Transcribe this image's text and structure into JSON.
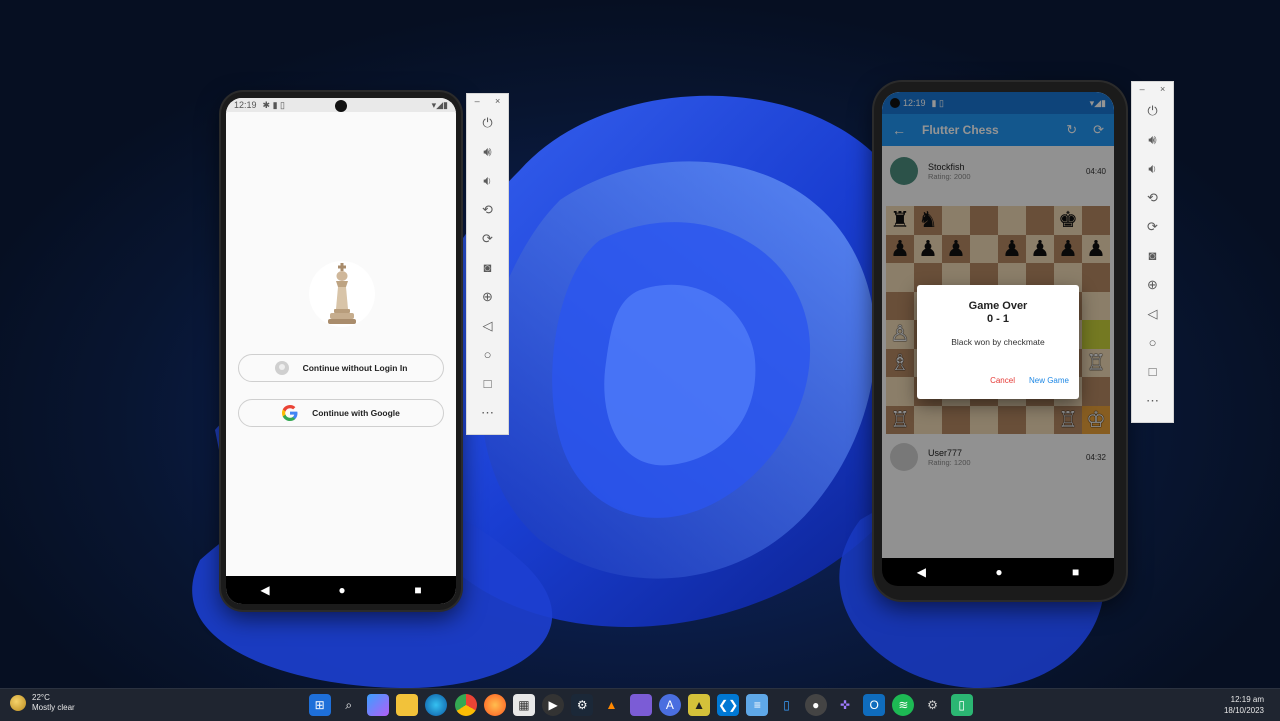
{
  "weather": {
    "temperature": "22°C",
    "condition": "Mostly clear"
  },
  "clock": {
    "time": "12:19 am",
    "date": "18/10/2023"
  },
  "phone_left": {
    "status_time": "12:19",
    "login_buttons": [
      {
        "label": "Continue without Login In",
        "icon": "avatar-icon"
      },
      {
        "label": "Continue with Google",
        "icon": "google-g-icon"
      }
    ],
    "nav": {
      "back": "◀",
      "home": "●",
      "recents": "■"
    }
  },
  "phone_right": {
    "status_time": "12:19",
    "app_title": "Flutter Chess",
    "opponent": {
      "name": "Stockfish",
      "rating": "Rating: 2000",
      "clock": "04:40"
    },
    "player": {
      "name": "User777",
      "rating": "Rating: 1200",
      "clock": "04:32"
    },
    "dialog": {
      "title": "Game Over",
      "score": "0 - 1",
      "message": "Black won by checkmate",
      "cancel": "Cancel",
      "new_game": "New Game"
    },
    "nav": {
      "back": "◀",
      "home": "●",
      "recents": "■"
    },
    "board_rows": [
      [
        "♜",
        "♞",
        "",
        "",
        "",
        "",
        "♚",
        ""
      ],
      [
        "♟",
        "♟",
        "♟",
        "",
        "♟",
        "♟",
        "♟",
        "♟"
      ],
      [
        "",
        "",
        "",
        "",
        "",
        "",
        "",
        ""
      ],
      [
        "",
        "",
        "",
        "",
        "",
        "",
        "",
        ""
      ],
      [
        "♙",
        "",
        "",
        "",
        "",
        "",
        "",
        ""
      ],
      [
        "♗",
        "",
        "",
        "",
        "",
        "",
        "",
        "♖"
      ],
      [
        "",
        "",
        "",
        "",
        "",
        "",
        "",
        ""
      ],
      [
        "♖",
        "",
        "",
        "",
        "",
        "",
        "♖",
        "♔"
      ]
    ]
  },
  "emulator_toolbar": {
    "minimize": "–",
    "close": "×",
    "icons": [
      "power-icon",
      "volume-up-icon",
      "volume-down-icon",
      "rotate-left-icon",
      "rotate-right-icon",
      "camera-icon",
      "zoom-icon",
      "back-icon",
      "home-icon",
      "overview-icon",
      "more-icon"
    ]
  },
  "taskbar_apps": [
    "windows-start-icon",
    "search-icon",
    "copilot-icon",
    "file-explorer-icon",
    "edge-icon",
    "chrome-icon",
    "firefox-icon",
    "store-icon",
    "media-player-icon",
    "steam-icon",
    "vlc-icon",
    "clapper-icon",
    "ai-app-icon",
    "android-studio-icon",
    "vscode-icon",
    "notepad-icon",
    "phone-link-icon",
    "github-desktop-icon",
    "game-controller-icon",
    "outlook-icon",
    "spotify-icon",
    "settings-icon",
    "notes-app-icon"
  ],
  "accent": "#2196f3"
}
